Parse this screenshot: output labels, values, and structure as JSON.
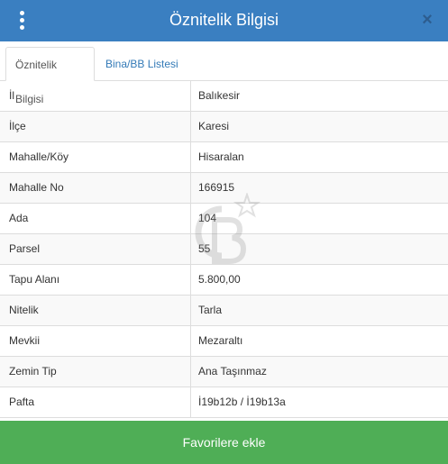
{
  "header": {
    "title": "Öznitelik Bilgisi",
    "close_label": "×"
  },
  "tabs": [
    {
      "label": "Öznitelik Bilgisi",
      "active": true
    },
    {
      "label": "Bina/BB Listesi",
      "active": false
    }
  ],
  "attributes": [
    {
      "key": "İl",
      "value": "Balıkesir"
    },
    {
      "key": "İlçe",
      "value": "Karesi"
    },
    {
      "key": "Mahalle/Köy",
      "value": "Hisaralan"
    },
    {
      "key": "Mahalle No",
      "value": "166915"
    },
    {
      "key": "Ada",
      "value": "104"
    },
    {
      "key": "Parsel",
      "value": "55"
    },
    {
      "key": "Tapu Alanı",
      "value": "5.800,00"
    },
    {
      "key": "Nitelik",
      "value": "Tarla"
    },
    {
      "key": "Mevkii",
      "value": "Mezaraltı"
    },
    {
      "key": "Zemin Tip",
      "value": "Ana Taşınmaz"
    },
    {
      "key": "Pafta",
      "value": "İ19b12b / İ19b13a"
    }
  ],
  "footer": {
    "button_label": "Favorilere ekle"
  },
  "colors": {
    "header_bg": "#3a7fc1",
    "tab_link": "#337ab7",
    "footer_bg": "#4fae56"
  },
  "icons": {
    "menu": "vertical-ellipsis-icon",
    "close": "close-icon",
    "watermark": "cb-logo-icon"
  }
}
